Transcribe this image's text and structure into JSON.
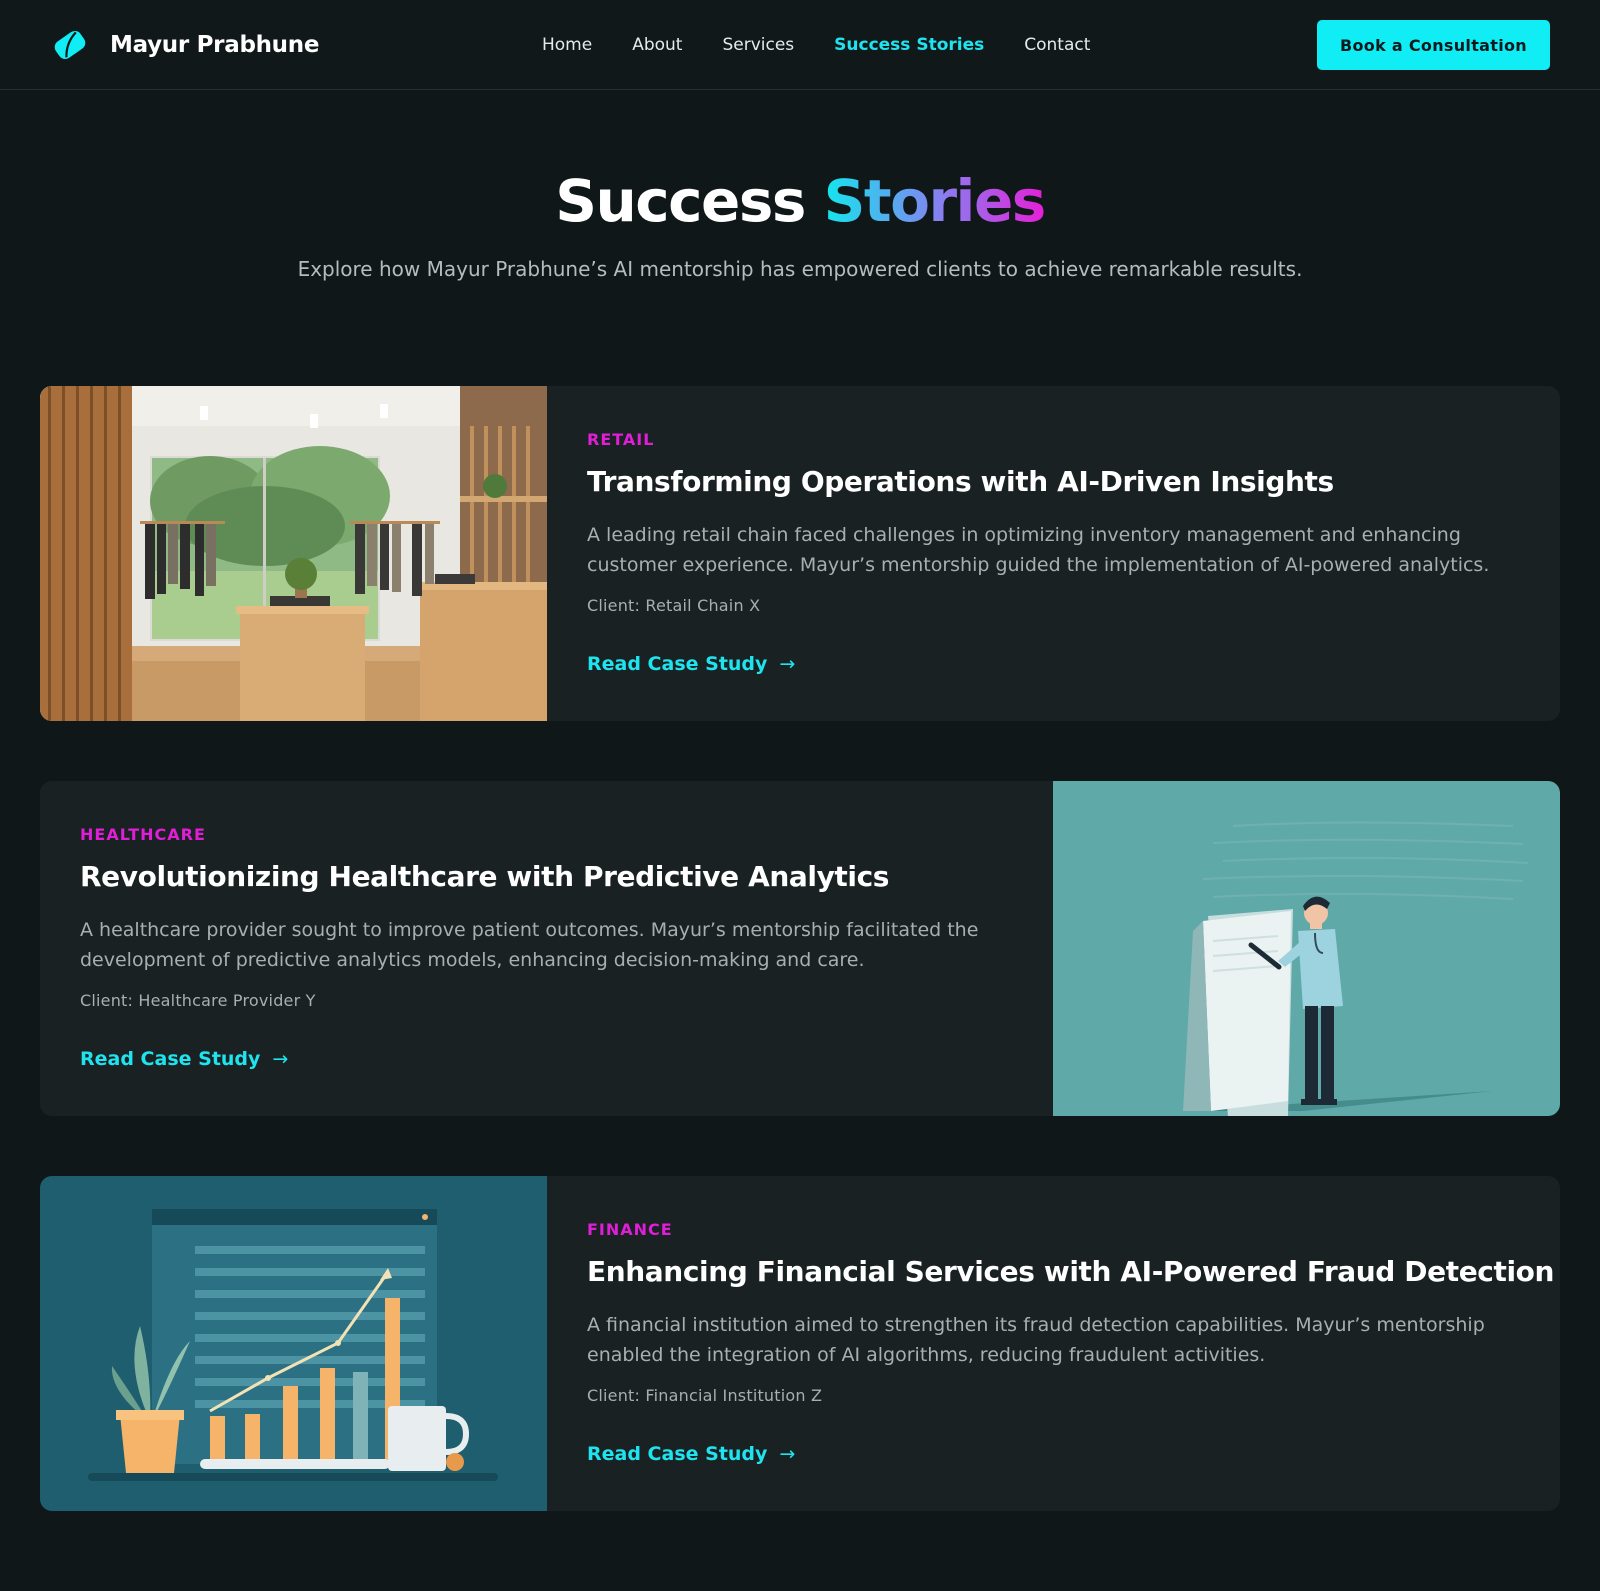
{
  "header": {
    "brand_name": "Mayur Prabhune",
    "nav": [
      "Home",
      "About",
      "Services",
      "Success Stories",
      "Contact"
    ],
    "active_nav": "Success Stories",
    "cta_label": "Book a Consultation"
  },
  "hero": {
    "title_part1": "Success",
    "title_part2": "Stories",
    "subtitle": "Explore how Mayur Prabhune’s AI mentorship has empowered clients to achieve remarkable results."
  },
  "stories": [
    {
      "tag": "RETAIL",
      "title": "Transforming Operations with AI-Driven Insights",
      "description": "A leading retail chain faced challenges in optimizing inventory management and enhancing customer experience. Mayur’s mentorship guided the implementation of AI-powered analytics.",
      "client": "Client: Retail Chain X",
      "link": "Read Case Study",
      "arrow": "→"
    },
    {
      "tag": "HEALTHCARE",
      "title": "Revolutionizing Healthcare with Predictive Analytics",
      "description": "A healthcare provider sought to improve patient outcomes. Mayur’s mentorship facilitated the development of predictive analytics models, enhancing decision-making and care.",
      "client": "Client: Healthcare Provider Y",
      "link": "Read Case Study",
      "arrow": "→"
    },
    {
      "tag": "FINANCE",
      "title": "Enhancing Financial Services with AI-Powered Fraud Detection",
      "description": "A financial institution aimed to strengthen its fraud detection capabilities. Mayur’s mentorship enabled the integration of AI algorithms, reducing fraudulent activities.",
      "client": "Client: Financial Institution Z",
      "link": "Read Case Study",
      "arrow": "→"
    }
  ],
  "colors": {
    "accent": "#10edf5",
    "tag": "#e01ed8",
    "background": "#101718",
    "card": "#192122"
  },
  "icons": {
    "logo": "tilted-tag-logo-icon",
    "link_arrow": "arrow-right-icon"
  }
}
